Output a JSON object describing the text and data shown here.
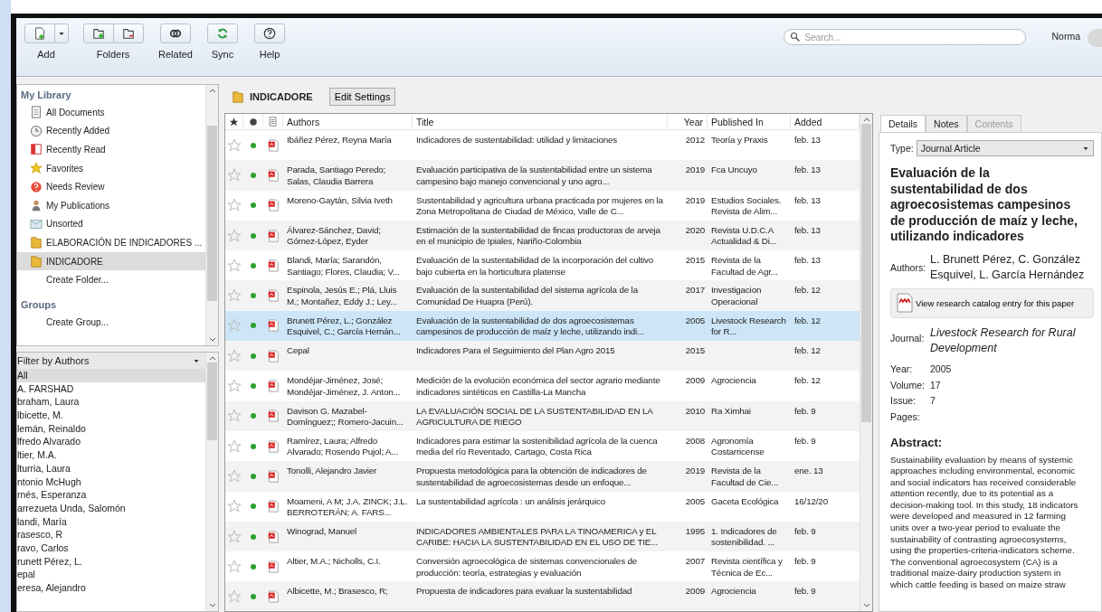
{
  "toolbar": {
    "buttons": [
      {
        "label": "Add",
        "dropdown": true
      },
      {
        "label": "Folders",
        "dropdown": false
      },
      {
        "label": "Related",
        "dropdown": false
      },
      {
        "label": "Sync",
        "dropdown": false
      },
      {
        "label": "Help",
        "dropdown": false
      }
    ],
    "search": {
      "placeholder": "Search..."
    },
    "user": "Norma"
  },
  "library": {
    "heading": "My Library",
    "items": [
      {
        "label": "All Documents",
        "selected": false
      },
      {
        "label": "Recently Added",
        "selected": false
      },
      {
        "label": "Recently Read",
        "selected": false
      },
      {
        "label": "Favorites",
        "selected": false
      },
      {
        "label": "Needs Review",
        "selected": false
      },
      {
        "label": "My Publications",
        "selected": false
      },
      {
        "label": "Unsorted",
        "selected": false
      },
      {
        "label": "ELABORACIÓN DE INDICADORES ...",
        "selected": false
      },
      {
        "label": "INDICADORE",
        "selected": true
      },
      {
        "label": "Create Folder...",
        "selected": false
      }
    ],
    "groups_heading": "Groups",
    "groups_items": [
      "Create Group..."
    ]
  },
  "filter": {
    "title": "Filter by Authors",
    "items": [
      {
        "label": "All",
        "selected": true
      },
      {
        "label": "A. FARSHAD",
        "selected": false
      },
      {
        "label": "braham, Laura",
        "selected": false
      },
      {
        "label": "lbicette, M.",
        "selected": false
      },
      {
        "label": "lemán, Reinaldo",
        "selected": false
      },
      {
        "label": "lfredo Alvarado",
        "selected": false
      },
      {
        "label": "ltier, M.A.",
        "selected": false
      },
      {
        "label": "lturria, Laura",
        "selected": false
      },
      {
        "label": "ntonio McHugh",
        "selected": false
      },
      {
        "label": "rnés, Esperanza",
        "selected": false
      },
      {
        "label": "arrezueta Unda, Salomón",
        "selected": false
      },
      {
        "label": "landi, María",
        "selected": false
      },
      {
        "label": "rasesco, R",
        "selected": false
      },
      {
        "label": "ravo, Carlos",
        "selected": false
      },
      {
        "label": "runett Pérez, L.",
        "selected": false
      },
      {
        "label": "epal",
        "selected": false
      },
      {
        "label": "eresa, Alejandro",
        "selected": false
      }
    ]
  },
  "folder": {
    "name": "INDICADORE",
    "button": "Edit Settings"
  },
  "table": {
    "columns": [
      "Authors",
      "Title",
      "Year",
      "Published In",
      "Added"
    ],
    "rows": [
      {
        "favorite": false,
        "read": true,
        "authors": "Ibáñez Pérez, Reyna María",
        "title": "Indicadores de sustentabilidad: utilidad y limitaciones",
        "year": "2012",
        "published_in": "Teoría y Praxis",
        "added": "feb. 13",
        "selected": false
      },
      {
        "favorite": false,
        "read": true,
        "authors": "Parada, Santiago Peredo; Salas, Claudia Barrera",
        "title": "Evaluación participativa de la sustentabilidad entre un sistema campesino bajo manejo convencional y uno agro...",
        "year": "2019",
        "published_in": "Fca Uncuyo",
        "added": "feb. 13",
        "selected": false
      },
      {
        "favorite": false,
        "read": true,
        "authors": "Moreno-Gaytán, Silvia Iveth",
        "title": "Sustentabilidad y agricultura urbana practicada por mujeres en la Zona Metropolitana de Ciudad de México, Valle de C...",
        "year": "2019",
        "published_in": "Estudios Sociales. Revista de Alim...",
        "added": "feb. 13",
        "selected": false
      },
      {
        "favorite": false,
        "read": true,
        "authors": "Álvarez-Sánchez, David; Gómez-López, Eyder",
        "title": "Estimación de la sustentabilidad de fincas productoras de arveja en el municipio de Ipiales, Nariño-Colombia",
        "year": "2020",
        "published_in": "Revista U.D.C.A Actualidad & Di...",
        "added": "feb. 13",
        "selected": false
      },
      {
        "favorite": false,
        "read": true,
        "authors": "Blandi, María; Sarandón, Santiago; Flores, Claudia; V...",
        "title": "Evaluación de la sustentabilidad de la incorporación del cultivo bajo cubierta en la horticultura platense",
        "year": "2015",
        "published_in": "Revista de la Facultad de Agr...",
        "added": "feb. 13",
        "selected": false
      },
      {
        "favorite": false,
        "read": true,
        "authors": "Espinola, Jesús E.; Plá, Lluis M.; Montañez, Eddy J.; Ley...",
        "title": "Evaluación de la sustentabilidad del sistema agrícola de la Comunidad De Huapra (Perú).",
        "year": "2017",
        "published_in": "Investigacion Operacional",
        "added": "feb. 12",
        "selected": false
      },
      {
        "favorite": false,
        "read": true,
        "authors": "Brunett Pérez, L.; González Esquivel, C.; García Hernán...",
        "title": "Evaluación de la sustentabilidad de dos agroecosistemas campesinos de producción de maíz y leche, utilizando indi...",
        "year": "2005",
        "published_in": "Livestock Research for R...",
        "added": "feb. 12",
        "selected": true
      },
      {
        "favorite": false,
        "read": true,
        "authors": "Cepal",
        "title": "Indicadores Para el Seguimiento del Plan Agro 2015",
        "year": "2015",
        "added": "feb. 12",
        "selected": false
      },
      {
        "favorite": false,
        "read": true,
        "authors": "Mondéjar-Jiménez, José; Mondéjar-Jiménez, J. Anton...",
        "title": "Medición de la evolución económica del sector agrario mediante indicadores sintéticos en Castilla-La Mancha",
        "year": "2009",
        "published_in": "Agrociencia",
        "added": "feb. 12",
        "selected": false
      },
      {
        "favorite": false,
        "read": true,
        "authors": "Davison G. Mazabel-Domínguez;; Romero-Jacuin...",
        "title": "LA EVALUACIÓN SOCIAL DE LA SUSTENTABILIDAD EN LA AGRICULTURA DE RIEGO",
        "year": "2010",
        "published_in": "Ra Ximhai",
        "added": "feb. 9",
        "selected": false
      },
      {
        "favorite": false,
        "read": true,
        "authors": "Ramírez, Laura; Alfredo Alvarado; Rosendo Pujol; A...",
        "title": "Indicadores para estimar la sostenibilidad agrícola de la cuenca media del río Reventado, Cartago, Costa Rica",
        "year": "2008",
        "published_in": "Agronomía Costarricense",
        "added": "feb. 9",
        "selected": false
      },
      {
        "favorite": false,
        "read": true,
        "authors": "Tonolli, Alejandro Javier",
        "title": "Propuesta metodológica para la obtención de indicadores de sustentabilidad de agroecosistemas desde un enfoque...",
        "year": "2019",
        "published_in": "Revista de la Facultad de Cie...",
        "added": "ene. 13",
        "selected": false
      },
      {
        "favorite": false,
        "read": true,
        "authors": "Moameni, A M; J.A. ZINCK; J.L. BERROTERÁN; A. FARS...",
        "title": "La sustentabilidad agrícola : un análisis jerárquico",
        "year": "2005",
        "published_in": "Gaceta Ecológica",
        "added": "16/12/20",
        "selected": false
      },
      {
        "favorite": false,
        "read": true,
        "authors": "Winograd, Manuel",
        "title": "INDICADORES AMBIENTALES PARA LA TINOAMERICA y EL CARIBE: HACIA LA SUSTENTABILIDAD EN EL USO DE TIE...",
        "year": "1995",
        "published_in": "1. Indicadores de sostenibilidad. ...",
        "added": "feb. 9",
        "selected": false
      },
      {
        "favorite": false,
        "read": true,
        "authors": "Altier, M.A.; Nicholls, C.I.",
        "title": "Conversión agroecológica de sistemas convencionales de producción: teoría, estrategias y evaluación",
        "year": "2007",
        "published_in": "Revista científica y Técnica de Ec...",
        "added": "feb. 9",
        "selected": false
      },
      {
        "favorite": false,
        "read": true,
        "authors": "Albicette, M.; Brasesco, R;",
        "title": "Propuesta de indicadores para evaluar la sustentabilidad",
        "year": "2009",
        "published_in": "Agrociencia",
        "added": "feb. 9",
        "selected": false
      }
    ]
  },
  "details": {
    "tabs": [
      {
        "label": "Details",
        "selected": true,
        "disabled": false
      },
      {
        "label": "Notes",
        "selected": false,
        "disabled": false
      },
      {
        "label": "Contents",
        "selected": false,
        "disabled": true
      }
    ],
    "type_label": "Type:",
    "type_value": "Journal Article",
    "title": "Evaluación de la sustentabilidad de dos agroecosistemas campesinos de producción de maíz y leche, utilizando indicadores",
    "authors_label": "Authors:",
    "authors": "L. Brunett Pérez, C. González Esquivel, L. García Hernández",
    "catalog_button": "View research catalog entry for this paper",
    "journal_label": "Journal:",
    "journal": "Livestock Research for Rural Development",
    "fields": [
      {
        "label": "Year:",
        "value": "2005"
      },
      {
        "label": "Volume:",
        "value": "17"
      },
      {
        "label": "Issue:",
        "value": "7"
      },
      {
        "label": "Pages:"
      }
    ],
    "abstract_heading": "Abstract:",
    "abstract": "Sustainability evaluation by means of systemic approaches including environmental, economic and social indicators has received considerable attention recently, due to its potential as a decision-making tool. In this study, 18 indicators were developed and measured in 12 farming units over a two-year period to evaluate the sustainability of contrasting agroecosystems, using the properties-criteria-indicators scheme. The conventional agroecosystem (CA) is a traditional maize-dairy production system in which cattle feeding is based on maize straw"
  }
}
